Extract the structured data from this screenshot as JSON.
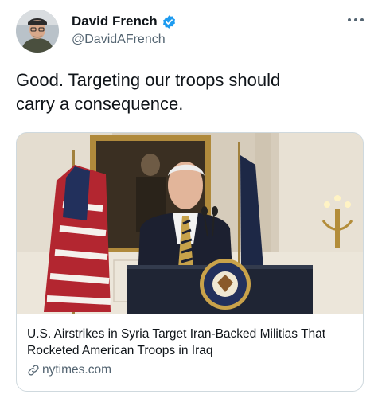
{
  "author": {
    "display_name": "David French",
    "handle": "@DavidAFrench",
    "verified": true
  },
  "tweet": {
    "text": "Good. Targeting our troops should\ncarry a consequence."
  },
  "link_card": {
    "title": "U.S. Airstrikes in Syria Target Iran-Backed Militias That Rocketed American Troops in Iraq",
    "domain": "nytimes.com"
  },
  "colors": {
    "verified_badge": "#1d9bf0",
    "text_primary": "#0f1419",
    "text_secondary": "#536471",
    "card_border": "#cfd9de"
  },
  "icons": [
    "verified-badge-icon",
    "more-options-icon",
    "link-icon"
  ]
}
